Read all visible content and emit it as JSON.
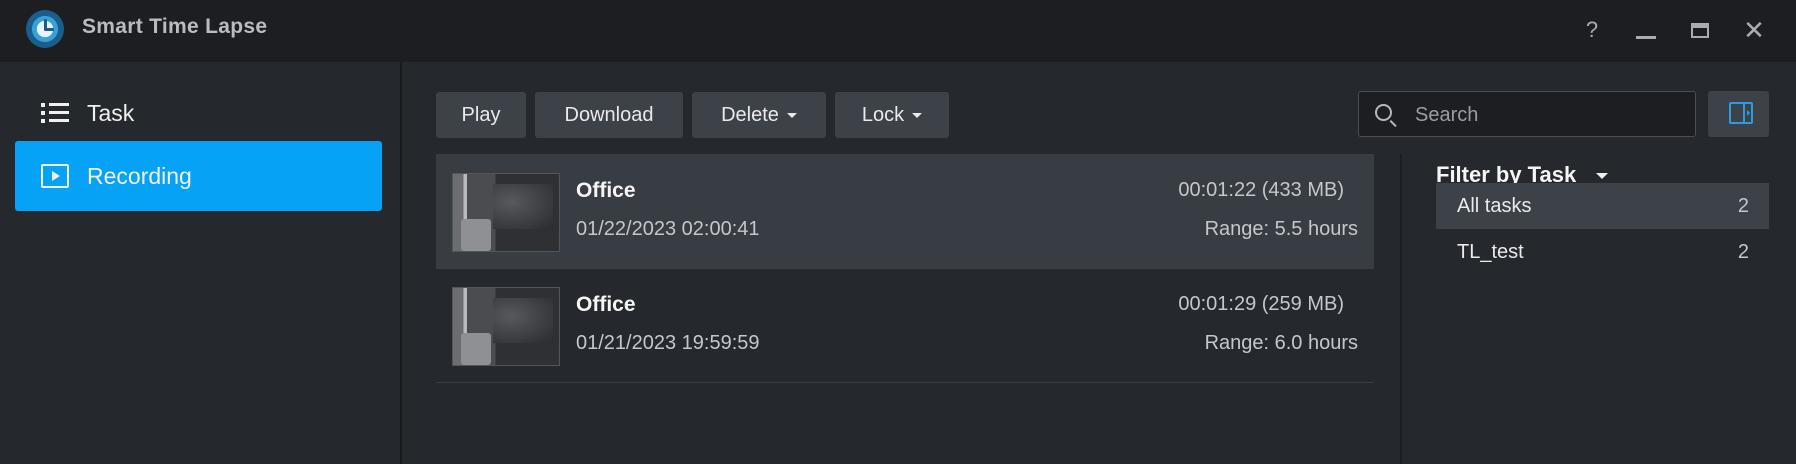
{
  "app": {
    "title": "Smart Time Lapse"
  },
  "window_controls": {
    "help": "?",
    "close": "✕"
  },
  "sidebar": {
    "items": [
      {
        "label": "Task",
        "icon": "list-icon",
        "active": false
      },
      {
        "label": "Recording",
        "icon": "play-box-icon",
        "active": true
      }
    ]
  },
  "toolbar": {
    "play_label": "Play",
    "download_label": "Download",
    "delete_label": "Delete",
    "lock_label": "Lock",
    "search_placeholder": "Search"
  },
  "recordings": [
    {
      "name": "Office",
      "date": "01/22/2023 02:00:41",
      "duration": "00:01:22 (433 MB)",
      "range": "Range: 5.5 hours",
      "selected": true
    },
    {
      "name": "Office",
      "date": "01/21/2023 19:59:59",
      "duration": "00:01:29 (259 MB)",
      "range": "Range: 6.0 hours",
      "selected": false
    }
  ],
  "filter": {
    "title": "Filter by Task",
    "items": [
      {
        "name": "All tasks",
        "count": "2",
        "active": true
      },
      {
        "name": "TL_test",
        "count": "2",
        "active": false
      }
    ]
  },
  "colors": {
    "accent": "#05a2f5",
    "background": "#25282c",
    "titlebar": "#1c1e21",
    "button": "#3d4249"
  }
}
